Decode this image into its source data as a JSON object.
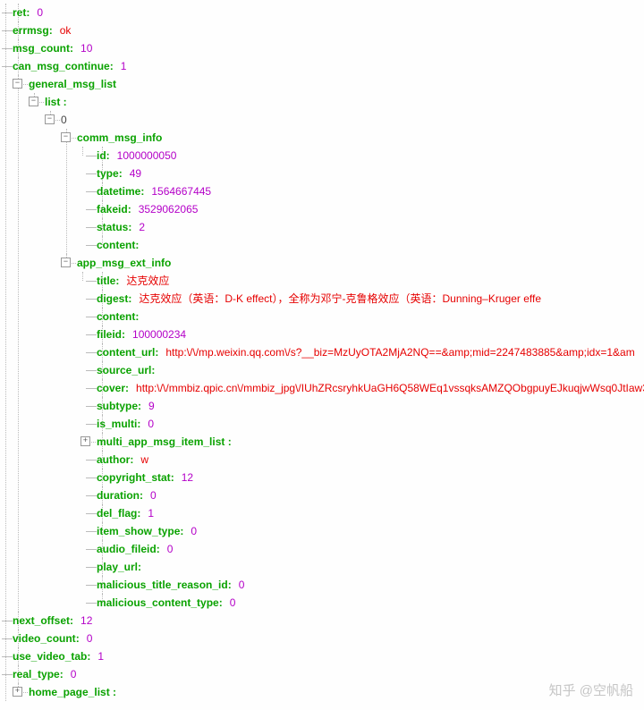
{
  "root": [
    {
      "k": "ret",
      "v": "0",
      "t": "num",
      "last": false
    },
    {
      "k": "errmsg",
      "v": "ok",
      "t": "str",
      "last": false
    },
    {
      "k": "msg_count",
      "v": "10",
      "t": "num",
      "last": false
    },
    {
      "k": "can_msg_continue",
      "v": "1",
      "t": "num",
      "last": false
    }
  ],
  "general_msg_list_label": "general_msg_list",
  "list_label": "list",
  "index_label": "0",
  "comm_msg_info_label": "comm_msg_info",
  "comm_msg_info": [
    {
      "k": "id",
      "v": "1000000050",
      "t": "num",
      "last": false
    },
    {
      "k": "type",
      "v": "49",
      "t": "num",
      "last": false
    },
    {
      "k": "datetime",
      "v": "1564667445",
      "t": "num",
      "last": false
    },
    {
      "k": "fakeid",
      "v": "3529062065",
      "t": "num",
      "last": false
    },
    {
      "k": "status",
      "v": "2",
      "t": "num",
      "last": false
    },
    {
      "k": "content",
      "v": "",
      "t": "str",
      "last": true
    }
  ],
  "app_msg_ext_info_label": "app_msg_ext_info",
  "app_msg_ext_info": [
    {
      "k": "title",
      "v": "达克效应",
      "t": "str"
    },
    {
      "k": "digest",
      "v": "达克效应（英语：D-K effect），全称为邓宁-克鲁格效应（英语：Dunning–Kruger effe",
      "t": "str"
    },
    {
      "k": "content",
      "v": "",
      "t": "str"
    },
    {
      "k": "fileid",
      "v": "100000234",
      "t": "num"
    },
    {
      "k": "content_url",
      "v": "http:\\/\\/mp.weixin.qq.com\\/s?__biz=MzUyOTA2MjA2NQ==&amp;mid=2247483885&amp;idx=1&am",
      "t": "str"
    },
    {
      "k": "source_url",
      "v": "",
      "t": "str"
    },
    {
      "k": "cover",
      "v": "http:\\/\\/mmbiz.qpic.cn\\/mmbiz_jpg\\/IUhZRcsryhkUaGH6Q58WEq1vssqksAMZQObgpuyEJkuqjwWsq0JtIaw3",
      "t": "str"
    },
    {
      "k": "subtype",
      "v": "9",
      "t": "num"
    },
    {
      "k": "is_multi",
      "v": "0",
      "t": "num"
    }
  ],
  "multi_label": "multi_app_msg_item_list",
  "app_msg_ext_info_tail": [
    {
      "k": "author",
      "v": "w",
      "t": "str"
    },
    {
      "k": "copyright_stat",
      "v": "12",
      "t": "num"
    },
    {
      "k": "duration",
      "v": "0",
      "t": "num"
    },
    {
      "k": "del_flag",
      "v": "1",
      "t": "num"
    },
    {
      "k": "item_show_type",
      "v": "0",
      "t": "num"
    },
    {
      "k": "audio_fileid",
      "v": "0",
      "t": "num"
    },
    {
      "k": "play_url",
      "v": "",
      "t": "str"
    },
    {
      "k": "malicious_title_reason_id",
      "v": "0",
      "t": "num"
    },
    {
      "k": "malicious_content_type",
      "v": "0",
      "t": "num",
      "last": true
    }
  ],
  "root_tail": [
    {
      "k": "next_offset",
      "v": "12",
      "t": "num"
    },
    {
      "k": "video_count",
      "v": "0",
      "t": "num"
    },
    {
      "k": "use_video_tab",
      "v": "1",
      "t": "num"
    },
    {
      "k": "real_type",
      "v": "0",
      "t": "num"
    }
  ],
  "home_page_list_label": "home_page_list",
  "watermark": "知乎 @空帆船"
}
